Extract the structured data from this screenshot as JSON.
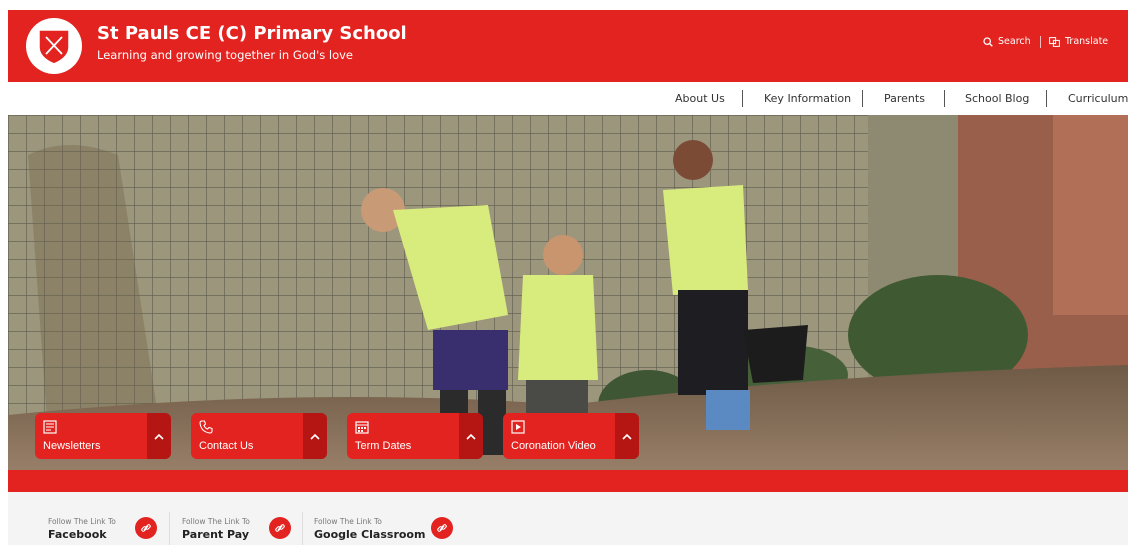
{
  "header": {
    "school_name": "St Pauls CE (C) Primary School",
    "motto": "Learning and growing together in God's love",
    "search_label": "Search",
    "translate_label": "Translate",
    "brand_color": "#e2231f"
  },
  "nav": {
    "items": [
      {
        "label": "About Us"
      },
      {
        "label": "Key Information"
      },
      {
        "label": "Parents"
      },
      {
        "label": "School Blog"
      },
      {
        "label": "Curriculum"
      }
    ]
  },
  "quick_links": [
    {
      "label": "Newsletters",
      "icon": "newsletter-icon"
    },
    {
      "label": "Contact Us",
      "icon": "phone-icon"
    },
    {
      "label": "Term Dates",
      "icon": "calendar-icon"
    },
    {
      "label": "Coronation Video",
      "icon": "video-icon"
    }
  ],
  "social": [
    {
      "prefix": "Follow The Link To",
      "name": "Facebook"
    },
    {
      "prefix": "Follow The Link To",
      "name": "Parent Pay"
    },
    {
      "prefix": "Follow The Link To",
      "name": "Google Classroom"
    }
  ]
}
